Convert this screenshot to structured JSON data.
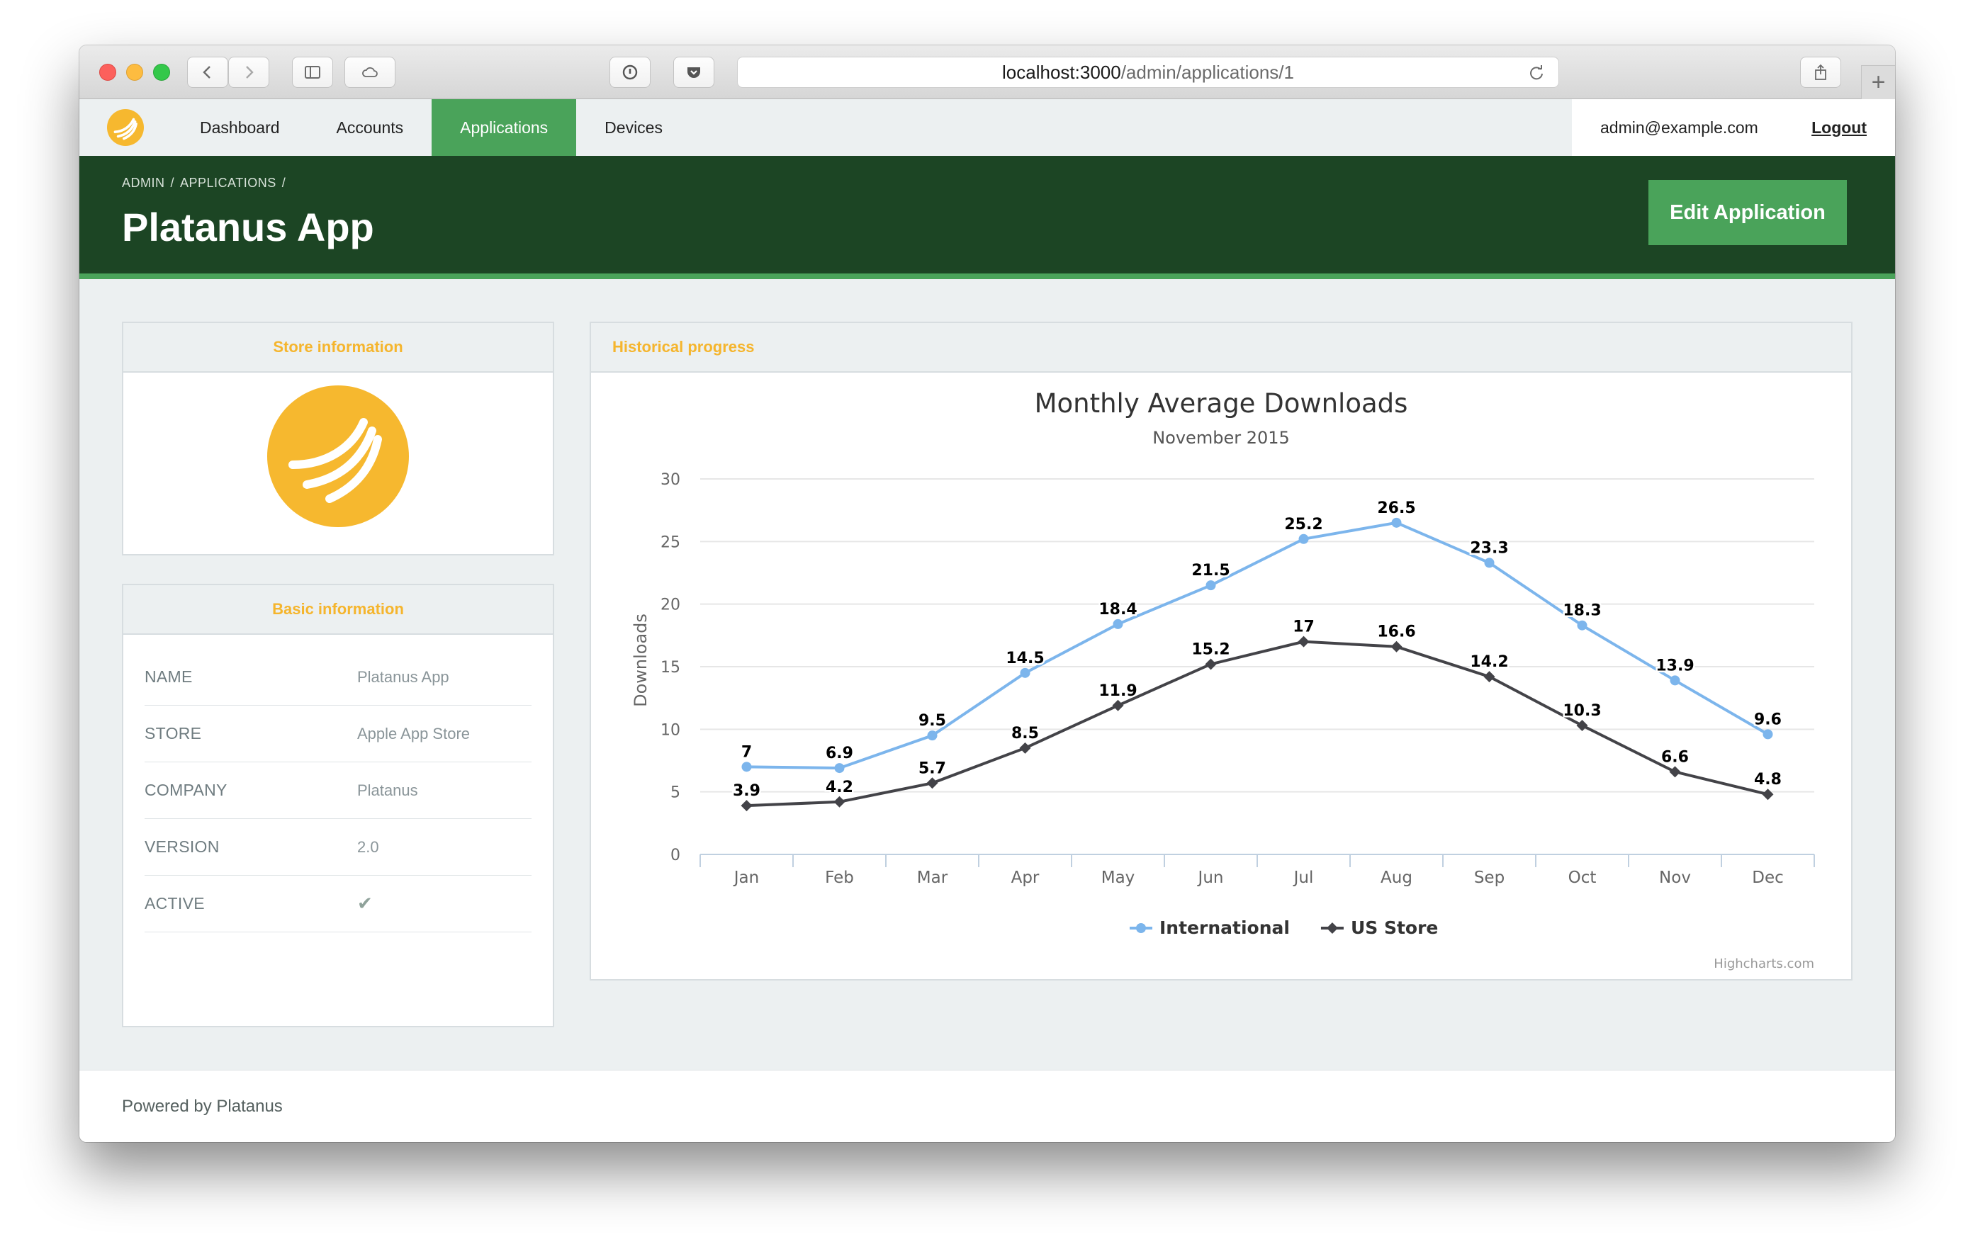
{
  "browser": {
    "url_host": "localhost:3000",
    "url_path": "/admin/applications/1"
  },
  "nav": {
    "items": [
      {
        "label": "Dashboard",
        "active": false
      },
      {
        "label": "Accounts",
        "active": false
      },
      {
        "label": "Applications",
        "active": true
      },
      {
        "label": "Devices",
        "active": false
      }
    ],
    "user_email": "admin@example.com",
    "logout_label": "Logout"
  },
  "header": {
    "breadcrumb": [
      "ADMIN",
      "/",
      "APPLICATIONS",
      "/"
    ],
    "title": "Platanus App",
    "edit_label": "Edit Application"
  },
  "store_panel": {
    "title": "Store information"
  },
  "basic_panel": {
    "title": "Basic information",
    "rows": [
      {
        "key": "NAME",
        "value": "Platanus App"
      },
      {
        "key": "STORE",
        "value": "Apple App Store"
      },
      {
        "key": "COMPANY",
        "value": "Platanus"
      },
      {
        "key": "VERSION",
        "value": "2.0"
      },
      {
        "key": "ACTIVE",
        "value": "✔"
      }
    ]
  },
  "history_panel": {
    "title": "Historical progress"
  },
  "chart_data": {
    "type": "line",
    "title": "Monthly Average Downloads",
    "subtitle": "November 2015",
    "ylabel": "Downloads",
    "xlabel": "",
    "categories": [
      "Jan",
      "Feb",
      "Mar",
      "Apr",
      "May",
      "Jun",
      "Jul",
      "Aug",
      "Sep",
      "Oct",
      "Nov",
      "Dec"
    ],
    "ylim": [
      0,
      30
    ],
    "yticks": [
      0,
      5,
      10,
      15,
      20,
      25,
      30
    ],
    "grid": true,
    "legend_position": "bottom-center",
    "series": [
      {
        "name": "International",
        "color": "#7cb5ec",
        "marker": "circle",
        "values": [
          7,
          6.9,
          9.5,
          14.5,
          18.4,
          21.5,
          25.2,
          26.5,
          23.3,
          18.3,
          13.9,
          9.6
        ]
      },
      {
        "name": "US Store",
        "color": "#434348",
        "marker": "diamond",
        "values": [
          3.9,
          4.2,
          5.7,
          8.5,
          11.9,
          15.2,
          17,
          16.6,
          14.2,
          10.3,
          6.6,
          4.8
        ]
      }
    ],
    "credits": "Highcharts.com"
  },
  "footer": {
    "text": "Powered by Platanus"
  },
  "colors": {
    "accent": "#4aa35a",
    "header_bg": "#1c4524",
    "panel_title": "#f5b52d",
    "logo": "#f6b82f"
  }
}
